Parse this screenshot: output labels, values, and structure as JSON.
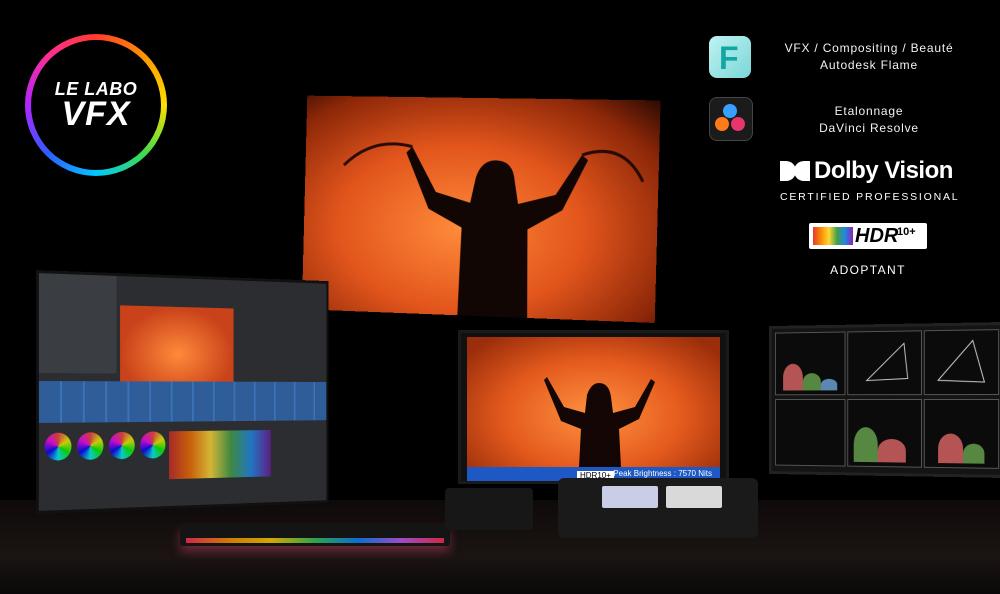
{
  "logo": {
    "line1": "LE LABO",
    "line2": "VFX"
  },
  "credentials": {
    "flame": {
      "icon": "autodesk-flame-icon",
      "letter": "F",
      "line1": "VFX / Compositing / Beauté",
      "line2": "Autodesk Flame"
    },
    "resolve": {
      "icon": "davinci-resolve-icon",
      "line1": "Etalonnage",
      "line2": "DaVinci Resolve"
    },
    "dolby": {
      "word": "Dolby Vision",
      "certification": "CERTIFIED PROFESSIONAL"
    },
    "hdr10": {
      "word": "HDR",
      "superscript": "10+",
      "caption": "ADOPTANT"
    }
  },
  "center_monitor": {
    "status": "Peak Brightness : 7570 Nits",
    "badge": "HDR10+"
  },
  "colors": {
    "ring": [
      "#ff3b30",
      "#ff9500",
      "#ffe000",
      "#3ddc4a",
      "#00c8ff",
      "#2f5bff",
      "#b026ff",
      "#ff2d95"
    ],
    "screen_orange": "#e2551c",
    "status_bar": "#1d58c4"
  }
}
